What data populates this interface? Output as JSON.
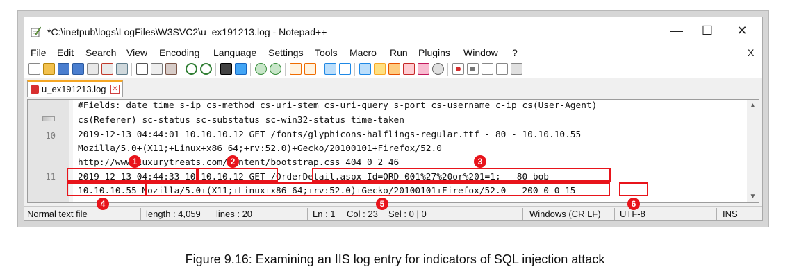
{
  "window": {
    "title": "*C:\\inetpub\\logs\\LogFiles\\W3SVC2\\u_ex191213.log - Notepad++",
    "minimize": "—",
    "maximize": "☐",
    "close": "✕"
  },
  "menu": {
    "items": [
      "File",
      "Edit",
      "Search",
      "View",
      "Encoding",
      "Language",
      "Settings",
      "Tools",
      "Macro",
      "Run",
      "Plugins",
      "Window",
      "?"
    ],
    "close_doc": "X"
  },
  "tab": {
    "label": "u_ex191213.log",
    "close": "✕"
  },
  "editor": {
    "lines": [
      {
        "num": "",
        "text": "#Fields: date time s-ip cs-method cs-uri-stem cs-uri-query s-port cs-username c-ip cs(User-Agent)"
      },
      {
        "num": "",
        "text": "cs(Referer) sc-status sc-substatus sc-win32-status time-taken"
      },
      {
        "num": "10",
        "text": "2019-12-13 04:44:01 10.10.10.12 GET /fonts/glyphicons-halflings-regular.ttf - 80 - 10.10.10.55"
      },
      {
        "num": "",
        "text": "Mozilla/5.0+(X11;+Linux+x86_64;+rv:52.0)+Gecko/20100101+Firefox/52.0"
      },
      {
        "num": "",
        "text": "http://www.luxurytreats.com/Content/bootstrap.css 404 0 2 46"
      },
      {
        "num": "11",
        "text": "2019-12-13 04:44:33 10.10.10.12 GET /OrderDetail.aspx Id=ORD-001%27%20or%201=1;-- 80 bob"
      },
      {
        "num": "",
        "text": "10.10.10.55 Mozilla/5.0+(X11;+Linux+x86_64;+rv:52.0)+Gecko/20100101+Firefox/52.0 - 200 0 0 15"
      }
    ],
    "scroll_up": "▲",
    "scroll_down": "▼"
  },
  "status": {
    "file_type": "Normal text file",
    "length": "length : 4,059",
    "lines": "lines : 20",
    "ln": "Ln : 1",
    "col": "Col : 23",
    "sel": "Sel : 0 | 0",
    "eol": "Windows (CR LF)",
    "encoding": "UTF-8",
    "mode": "INS"
  },
  "annotations": [
    "1",
    "2",
    "3",
    "4",
    "5",
    "6"
  ],
  "caption": "Figure 9.16: Examining an IIS log entry for indicators of SQL injection attack"
}
